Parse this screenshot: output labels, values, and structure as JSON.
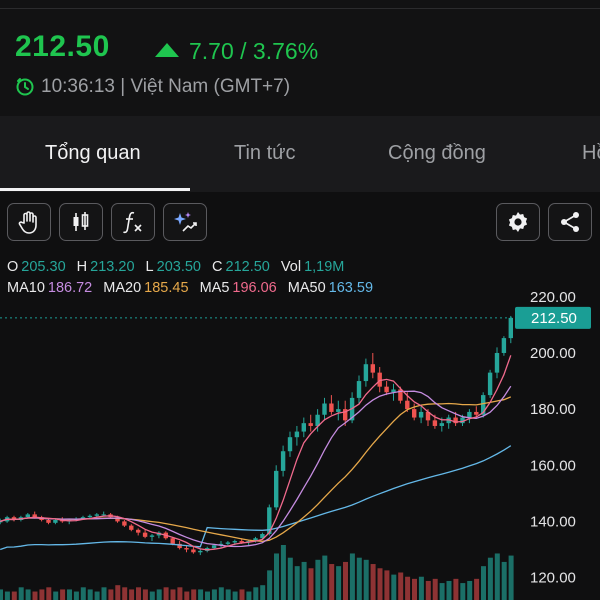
{
  "header": {
    "price": "212.50",
    "change": "7.70 / 3.76%",
    "time": "10:36:13 | Việt Nam (GMT+7)"
  },
  "tabs": [
    {
      "label": "Tổng quan",
      "active": true
    },
    {
      "label": "Tin tức",
      "active": false
    },
    {
      "label": "Cộng đồng",
      "active": false
    },
    {
      "label": "Hồ",
      "active": false
    }
  ],
  "toolbar": {
    "left_icons": [
      "hand-icon",
      "candlestick-icon",
      "function-icon",
      "ai-sparkle-icon"
    ],
    "right_icons": [
      "gear-icon",
      "share-icon"
    ]
  },
  "ohlc": {
    "o_label": "O",
    "o": "205.30",
    "h_label": "H",
    "h": "213.20",
    "l_label": "L",
    "l": "203.50",
    "c_label": "C",
    "c": "212.50",
    "vol_label": "Vol",
    "vol": "1,19M"
  },
  "ma": {
    "ma10_label": "MA10",
    "ma10": "186.72",
    "ma20_label": "MA20",
    "ma20": "185.45",
    "ma5_label": "MA5",
    "ma5": "196.06",
    "ma50_label": "MA50",
    "ma50": "163.59"
  },
  "colors": {
    "up": "#1fc54f",
    "candle_up": "#26a69a",
    "candle_down": "#ef5350",
    "o": "#26a69a",
    "h": "#26a69a",
    "l": "#26a69a",
    "c": "#26a69a",
    "vol": "#26a69a",
    "ma10": "#c58ce0",
    "ma20": "#e6a84a",
    "ma5": "#f06a8d",
    "ma50": "#64b8e8",
    "price_badge": "#1a9e95"
  },
  "chart_data": {
    "type": "candlestick",
    "y_ticks": [
      "220.00",
      "200.00",
      "180.00",
      "160.00",
      "140.00",
      "120.00"
    ],
    "ylim": [
      112,
      226
    ],
    "last_price_label": "212.50",
    "last_price": 212.5,
    "candles": [
      [
        140,
        141,
        139,
        140
      ],
      [
        140,
        142,
        139.5,
        141.5
      ],
      [
        141.5,
        142,
        140,
        140.5
      ],
      [
        140.5,
        142,
        140,
        141.5
      ],
      [
        141.5,
        143,
        141,
        142.5
      ],
      [
        142.5,
        143.5,
        141,
        141.5
      ],
      [
        141.5,
        142,
        140,
        140.5
      ],
      [
        140.5,
        141,
        139,
        139.5
      ],
      [
        139.5,
        141,
        139,
        140.5
      ],
      [
        140.5,
        141.5,
        139.5,
        140
      ],
      [
        140,
        141,
        139,
        140.5
      ],
      [
        140.5,
        141.5,
        140,
        141
      ],
      [
        141,
        142,
        140.5,
        141.5
      ],
      [
        141.5,
        142.5,
        141,
        142
      ],
      [
        142,
        143,
        141.5,
        142.5
      ],
      [
        142.5,
        143.5,
        142,
        142.5
      ],
      [
        142.5,
        143,
        141,
        141.5
      ],
      [
        141.5,
        142,
        139.5,
        140
      ],
      [
        140,
        140.5,
        138,
        138.5
      ],
      [
        138.5,
        139,
        136.5,
        137
      ],
      [
        137,
        137.5,
        135,
        136
      ],
      [
        136,
        137,
        134,
        134.5
      ],
      [
        134.5,
        135.5,
        133,
        135
      ],
      [
        135,
        136.5,
        134,
        136
      ],
      [
        136,
        136.5,
        133.5,
        134
      ],
      [
        134,
        134.5,
        131.5,
        132
      ],
      [
        132,
        133,
        130,
        130.5
      ],
      [
        130.5,
        131.5,
        129,
        130
      ],
      [
        130,
        131,
        128.5,
        129
      ],
      [
        129,
        130,
        128,
        129.5
      ],
      [
        129.5,
        131,
        129,
        130.5
      ],
      [
        130.5,
        132,
        130,
        131.5
      ],
      [
        131.5,
        133,
        130.5,
        132
      ],
      [
        132,
        133,
        131,
        132.5
      ],
      [
        132.5,
        133.5,
        131.5,
        133
      ],
      [
        133,
        134,
        132,
        132.5
      ],
      [
        132.5,
        133.5,
        131.5,
        133
      ],
      [
        133,
        134.5,
        132.5,
        134
      ],
      [
        134,
        136,
        133.5,
        135.5
      ],
      [
        135.5,
        146,
        135,
        145
      ],
      [
        145,
        160,
        144,
        158
      ],
      [
        158,
        167,
        156,
        165
      ],
      [
        165,
        172,
        163,
        170
      ],
      [
        170,
        174,
        167,
        172
      ],
      [
        172,
        177,
        170,
        175
      ],
      [
        175,
        178,
        172,
        174
      ],
      [
        174,
        180,
        172,
        178
      ],
      [
        178,
        184,
        176,
        182
      ],
      [
        182,
        185,
        178,
        179
      ],
      [
        179,
        183,
        176,
        180
      ],
      [
        180,
        183,
        174,
        176
      ],
      [
        176,
        186,
        175,
        184
      ],
      [
        184,
        192,
        182,
        190
      ],
      [
        190,
        198,
        188,
        196
      ],
      [
        196,
        200,
        191,
        193
      ],
      [
        193,
        195,
        186,
        188
      ],
      [
        188,
        190,
        185,
        186
      ],
      [
        186,
        189,
        183,
        187
      ],
      [
        187,
        188,
        182,
        183
      ],
      [
        183,
        186,
        179,
        180
      ],
      [
        180,
        182,
        176,
        177
      ],
      [
        177,
        181,
        175,
        179
      ],
      [
        179,
        180,
        174,
        176
      ],
      [
        176,
        178,
        173,
        174
      ],
      [
        174,
        177,
        172,
        175
      ],
      [
        175,
        178,
        173,
        177
      ],
      [
        177,
        179,
        174,
        175
      ],
      [
        175,
        178,
        174,
        177
      ],
      [
        177,
        180,
        175,
        179
      ],
      [
        179,
        181,
        177,
        178
      ],
      [
        178,
        186,
        177,
        185
      ],
      [
        185,
        194,
        184,
        193
      ],
      [
        193,
        202,
        191,
        200
      ],
      [
        200,
        206,
        199,
        205.3
      ],
      [
        205.3,
        213.2,
        203.5,
        212.5
      ]
    ],
    "volumes": [
      5,
      4,
      4,
      6,
      5,
      4,
      5,
      6,
      4,
      5,
      5,
      4,
      6,
      5,
      4,
      6,
      5,
      7,
      6,
      5,
      6,
      5,
      4,
      5,
      6,
      5,
      6,
      4,
      5,
      5,
      4,
      5,
      6,
      5,
      4,
      5,
      4,
      6,
      7,
      14,
      22,
      26,
      20,
      16,
      18,
      15,
      19,
      21,
      17,
      16,
      18,
      22,
      20,
      19,
      17,
      15,
      14,
      12,
      13,
      11,
      10,
      11,
      9,
      10,
      8,
      9,
      10,
      8,
      9,
      10,
      16,
      20,
      22,
      18,
      21
    ]
  }
}
